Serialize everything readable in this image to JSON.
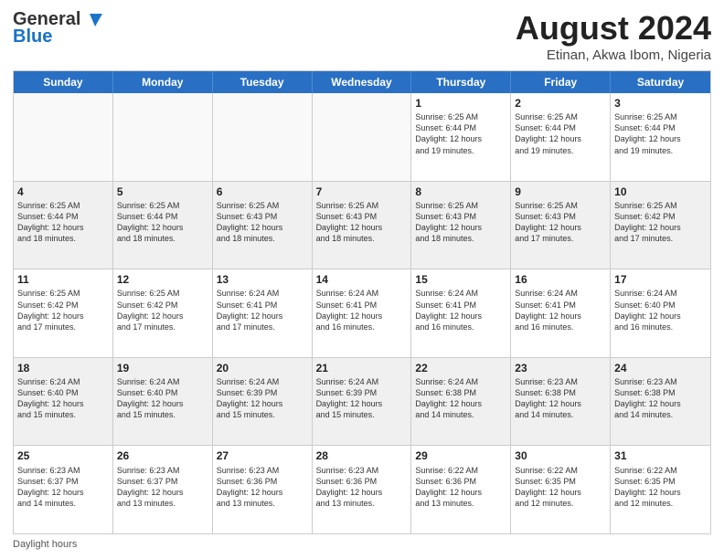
{
  "header": {
    "logo_line1": "General",
    "logo_line2": "Blue",
    "title": "August 2024",
    "subtitle": "Etinan, Akwa Ibom, Nigeria"
  },
  "days_of_week": [
    "Sunday",
    "Monday",
    "Tuesday",
    "Wednesday",
    "Thursday",
    "Friday",
    "Saturday"
  ],
  "weeks": [
    [
      {
        "day": "",
        "info": "",
        "empty": true
      },
      {
        "day": "",
        "info": "",
        "empty": true
      },
      {
        "day": "",
        "info": "",
        "empty": true
      },
      {
        "day": "",
        "info": "",
        "empty": true
      },
      {
        "day": "1",
        "info": "Sunrise: 6:25 AM\nSunset: 6:44 PM\nDaylight: 12 hours\nand 19 minutes.",
        "empty": false
      },
      {
        "day": "2",
        "info": "Sunrise: 6:25 AM\nSunset: 6:44 PM\nDaylight: 12 hours\nand 19 minutes.",
        "empty": false
      },
      {
        "day": "3",
        "info": "Sunrise: 6:25 AM\nSunset: 6:44 PM\nDaylight: 12 hours\nand 19 minutes.",
        "empty": false
      }
    ],
    [
      {
        "day": "4",
        "info": "Sunrise: 6:25 AM\nSunset: 6:44 PM\nDaylight: 12 hours\nand 18 minutes.",
        "empty": false
      },
      {
        "day": "5",
        "info": "Sunrise: 6:25 AM\nSunset: 6:44 PM\nDaylight: 12 hours\nand 18 minutes.",
        "empty": false
      },
      {
        "day": "6",
        "info": "Sunrise: 6:25 AM\nSunset: 6:43 PM\nDaylight: 12 hours\nand 18 minutes.",
        "empty": false
      },
      {
        "day": "7",
        "info": "Sunrise: 6:25 AM\nSunset: 6:43 PM\nDaylight: 12 hours\nand 18 minutes.",
        "empty": false
      },
      {
        "day": "8",
        "info": "Sunrise: 6:25 AM\nSunset: 6:43 PM\nDaylight: 12 hours\nand 18 minutes.",
        "empty": false
      },
      {
        "day": "9",
        "info": "Sunrise: 6:25 AM\nSunset: 6:43 PM\nDaylight: 12 hours\nand 17 minutes.",
        "empty": false
      },
      {
        "day": "10",
        "info": "Sunrise: 6:25 AM\nSunset: 6:42 PM\nDaylight: 12 hours\nand 17 minutes.",
        "empty": false
      }
    ],
    [
      {
        "day": "11",
        "info": "Sunrise: 6:25 AM\nSunset: 6:42 PM\nDaylight: 12 hours\nand 17 minutes.",
        "empty": false
      },
      {
        "day": "12",
        "info": "Sunrise: 6:25 AM\nSunset: 6:42 PM\nDaylight: 12 hours\nand 17 minutes.",
        "empty": false
      },
      {
        "day": "13",
        "info": "Sunrise: 6:24 AM\nSunset: 6:41 PM\nDaylight: 12 hours\nand 17 minutes.",
        "empty": false
      },
      {
        "day": "14",
        "info": "Sunrise: 6:24 AM\nSunset: 6:41 PM\nDaylight: 12 hours\nand 16 minutes.",
        "empty": false
      },
      {
        "day": "15",
        "info": "Sunrise: 6:24 AM\nSunset: 6:41 PM\nDaylight: 12 hours\nand 16 minutes.",
        "empty": false
      },
      {
        "day": "16",
        "info": "Sunrise: 6:24 AM\nSunset: 6:41 PM\nDaylight: 12 hours\nand 16 minutes.",
        "empty": false
      },
      {
        "day": "17",
        "info": "Sunrise: 6:24 AM\nSunset: 6:40 PM\nDaylight: 12 hours\nand 16 minutes.",
        "empty": false
      }
    ],
    [
      {
        "day": "18",
        "info": "Sunrise: 6:24 AM\nSunset: 6:40 PM\nDaylight: 12 hours\nand 15 minutes.",
        "empty": false
      },
      {
        "day": "19",
        "info": "Sunrise: 6:24 AM\nSunset: 6:40 PM\nDaylight: 12 hours\nand 15 minutes.",
        "empty": false
      },
      {
        "day": "20",
        "info": "Sunrise: 6:24 AM\nSunset: 6:39 PM\nDaylight: 12 hours\nand 15 minutes.",
        "empty": false
      },
      {
        "day": "21",
        "info": "Sunrise: 6:24 AM\nSunset: 6:39 PM\nDaylight: 12 hours\nand 15 minutes.",
        "empty": false
      },
      {
        "day": "22",
        "info": "Sunrise: 6:24 AM\nSunset: 6:38 PM\nDaylight: 12 hours\nand 14 minutes.",
        "empty": false
      },
      {
        "day": "23",
        "info": "Sunrise: 6:23 AM\nSunset: 6:38 PM\nDaylight: 12 hours\nand 14 minutes.",
        "empty": false
      },
      {
        "day": "24",
        "info": "Sunrise: 6:23 AM\nSunset: 6:38 PM\nDaylight: 12 hours\nand 14 minutes.",
        "empty": false
      }
    ],
    [
      {
        "day": "25",
        "info": "Sunrise: 6:23 AM\nSunset: 6:37 PM\nDaylight: 12 hours\nand 14 minutes.",
        "empty": false
      },
      {
        "day": "26",
        "info": "Sunrise: 6:23 AM\nSunset: 6:37 PM\nDaylight: 12 hours\nand 13 minutes.",
        "empty": false
      },
      {
        "day": "27",
        "info": "Sunrise: 6:23 AM\nSunset: 6:36 PM\nDaylight: 12 hours\nand 13 minutes.",
        "empty": false
      },
      {
        "day": "28",
        "info": "Sunrise: 6:23 AM\nSunset: 6:36 PM\nDaylight: 12 hours\nand 13 minutes.",
        "empty": false
      },
      {
        "day": "29",
        "info": "Sunrise: 6:22 AM\nSunset: 6:36 PM\nDaylight: 12 hours\nand 13 minutes.",
        "empty": false
      },
      {
        "day": "30",
        "info": "Sunrise: 6:22 AM\nSunset: 6:35 PM\nDaylight: 12 hours\nand 12 minutes.",
        "empty": false
      },
      {
        "day": "31",
        "info": "Sunrise: 6:22 AM\nSunset: 6:35 PM\nDaylight: 12 hours\nand 12 minutes.",
        "empty": false
      }
    ]
  ],
  "footer": {
    "daylight_label": "Daylight hours"
  },
  "colors": {
    "header_bg": "#2970c4",
    "header_text": "#ffffff",
    "cell_border": "#cccccc",
    "shaded_bg": "#f0f0f0"
  }
}
